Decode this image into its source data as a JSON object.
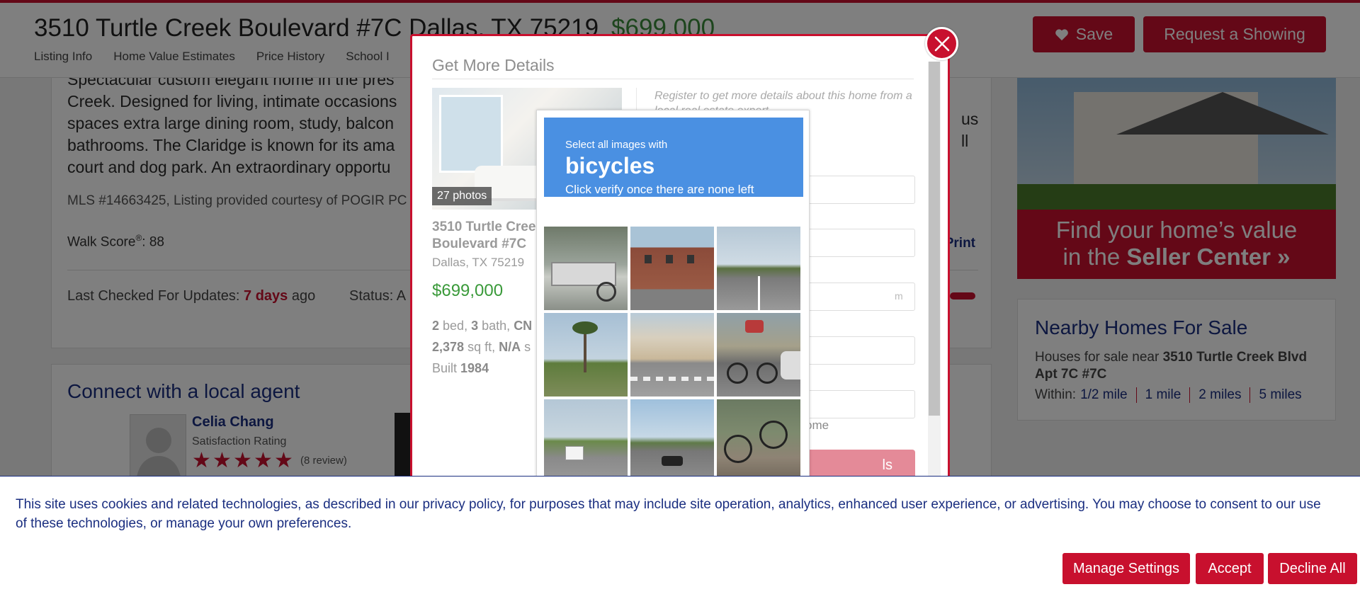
{
  "header": {
    "address": "3510 Turtle Creek Boulevard #7C Dallas, TX 75219",
    "price": "$699,000",
    "nav": [
      "Listing Info",
      "Home Value Estimates",
      "Price History",
      "School I"
    ],
    "save_label": "Save",
    "request_showing_label": "Request a Showing"
  },
  "listing": {
    "description": "Spectacular custom elegant home in the pres... Creek. Designed for living, intimate occasions... spaces extra large dining room, study, balcon... bathrooms. The Claridge is known for its ama... court and dog park. An extraordinary opportu...",
    "description_lines": [
      "Spectacular custom elegant home in the pres",
      "Creek. Designed for living, intimate occasions",
      "spaces extra large dining room, study, balcon",
      "bathrooms. The Claridge is known for its ama",
      "court and dog park. An extraordinary opportu"
    ],
    "description_tail": [
      "us",
      "ll"
    ],
    "mls": "MLS #14663425, Listing provided courtesy of POGIR PC",
    "walk_score_label": "Walk Score",
    "walk_score_reg": "®",
    "walk_score_value": ": 88",
    "print_label": "Print",
    "last_checked_label": "Last Checked For Updates:",
    "last_checked_value": "7 days",
    "last_checked_suffix": "ago",
    "status_label": "Status: A"
  },
  "agent_card": {
    "title": "Connect with a local agent",
    "agent_name": "Celia Chang",
    "satisfaction_label": "Satisfaction Rating",
    "rating": 5,
    "reviews": "(8 review)"
  },
  "ad": {
    "line1": "Find your home’s value",
    "line2_prefix": "in the ",
    "line2_bold": "Seller Center »"
  },
  "nearby": {
    "title": "Nearby Homes For Sale",
    "sub_prefix": "Houses for sale near ",
    "sub_bold": "3510 Turtle Creek Blvd Apt 7C #7C",
    "within_label": "Within:",
    "distances": [
      "1/2 mile",
      "1 mile",
      "2 miles",
      "5 miles"
    ]
  },
  "modal": {
    "title": "Get More Details",
    "photos_badge": "27 photos",
    "address": "3510 Turtle Creek Boulevard #7C",
    "address_lines": [
      "3510 Turtle Cree",
      "Boulevard #7C"
    ],
    "city": "Dallas, TX 75219",
    "price": "$699,000",
    "beds": "2",
    "beds_label": "bed,",
    "baths": "3",
    "baths_label": "bath,",
    "cn": "CN",
    "sqft": "2,378",
    "sqft_label": "sq ft,",
    "na": "N/A",
    "na_label": "s",
    "built_label": "Built",
    "built": "1984",
    "register_text": "Register to get more details about this home from a local real estate expert",
    "email_placeholder_fragment": "m",
    "home_note": "ome",
    "submit_fragment": "ls"
  },
  "captcha": {
    "instruction": "Select all images with",
    "target": "bicycles",
    "hint": "Click verify once there are none left",
    "tiles": [
      "bike-share-station",
      "brick-building-intersection",
      "highway-road",
      "palm-trees-road",
      "street-crossing",
      "cyclist-on-street",
      "ambulance-road",
      "road-with-car",
      "parked-bicycle"
    ]
  },
  "cookie": {
    "text": "This site uses cookies and related technologies, as described in our privacy policy, for purposes that may include site operation, analytics, enhanced user experience, or advertising. You may choose to consent to our use of these technologies, or manage your own preferences.",
    "manage_label": "Manage Settings",
    "accept_label": "Accept",
    "decline_label": "Decline All"
  },
  "colors": {
    "brand_red": "#c8102e",
    "navy": "#1a2e80",
    "price_green": "#3a8a3a",
    "captcha_blue": "#4a90e2"
  }
}
